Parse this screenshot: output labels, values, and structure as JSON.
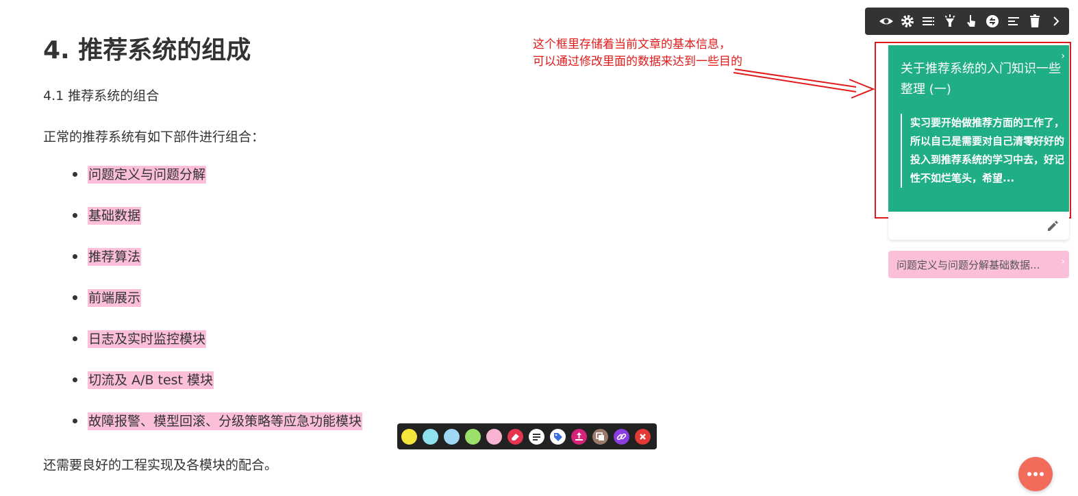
{
  "article": {
    "heading": "4. 推荐系统的组成",
    "subheading": "4.1 推荐系统的组合",
    "intro": "正常的推荐系统有如下部件进行组合：",
    "items": [
      "问题定义与问题分解",
      "基础数据",
      "推荐算法",
      "前端展示",
      "日志及实时监控模块",
      "切流及 A/B test 模块",
      "故障报警、模型回滚、分级策略等应急功能模块"
    ],
    "outro": "还需要良好的工程实现及各模块的配合。"
  },
  "toolbar": {
    "icons": [
      "eye-icon",
      "gear-icon",
      "list-icon",
      "flashlight-icon",
      "hand-pointer-icon",
      "sync-icon",
      "align-left-icon",
      "trash-icon",
      "chevron-right-icon"
    ]
  },
  "annotation": {
    "line1": "这个框里存储着当前文章的基本信息，",
    "line2": "可以通过修改里面的数据来达到一些目的",
    "color": "#e11a1a"
  },
  "info_card": {
    "title": "关于推荐系统的入门知识一些整理 (一)",
    "description": "实习要开始做推荐方面的工作了，所以自己是需要对自己清零好好的投入到推荐系统的学习中去，好记性不如烂笔头，希望...",
    "color": "#1fae86"
  },
  "highlight_item": {
    "text": "问题定义与问题分解基础数据...",
    "color": "#fbbfd9"
  },
  "color_bar": {
    "swatches": [
      "#f5e63c",
      "#8fe0ee",
      "#9ed8f5",
      "#9be06a",
      "#f8b4d2"
    ],
    "actions": [
      "eraser-icon",
      "note-icon",
      "tag-icon",
      "upload-icon",
      "copy-icon",
      "link-icon",
      "close-icon"
    ]
  },
  "fab": {
    "icon": "more-icon",
    "color": "#f26b5b"
  }
}
